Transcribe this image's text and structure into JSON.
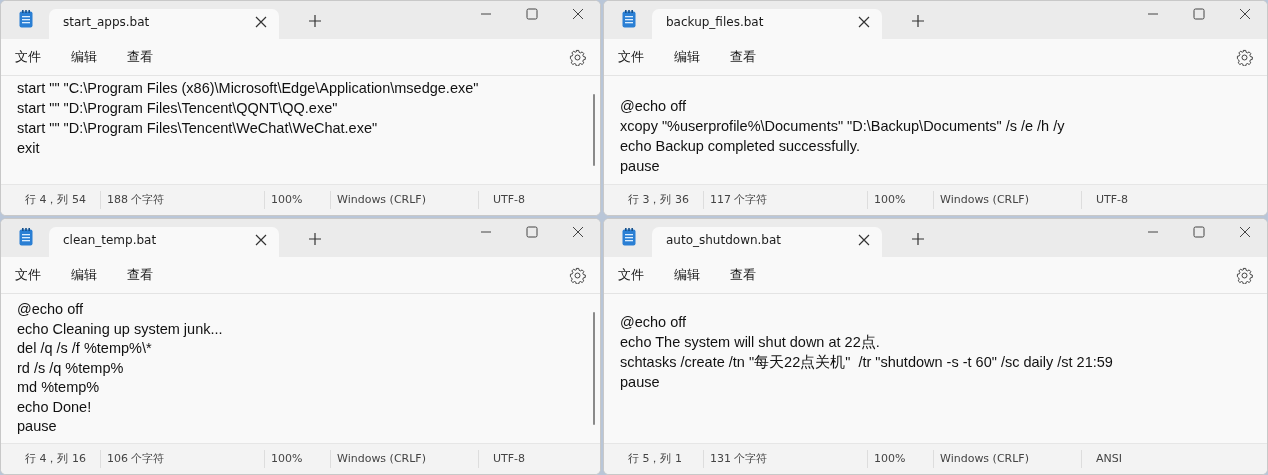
{
  "windows": [
    {
      "tab": {
        "title": "start_apps.bat",
        "selected": true
      },
      "menu": [
        "文件",
        "编辑",
        "查看"
      ],
      "scrollbar": true,
      "lines": [
        "start \"\" \"C:\\Program Files (x86)\\Microsoft\\Edge\\Application\\msedge.exe\"",
        "start \"\" \"D:\\Program Files\\Tencent\\QQNT\\QQ.exe\"",
        "start \"\" \"D:\\Program Files\\Tencent\\WeChat\\WeChat.exe\"",
        "exit"
      ],
      "status": {
        "position": "行 4，列 54",
        "characters": "188 个字符",
        "zoom": "100%",
        "line_ending": "Windows (CRLF)",
        "encoding": "UTF-8"
      }
    },
    {
      "tab": {
        "title": "backup_files.bat",
        "selected": true
      },
      "menu": [
        "文件",
        "编辑",
        "查看"
      ],
      "scrollbar": false,
      "lines": [
        "@echo off",
        "xcopy \"%userprofile%\\Documents\" \"D:\\Backup\\Documents\" /s /e /h /y",
        "echo Backup completed successfully.",
        "pause"
      ],
      "status": {
        "position": "行 3，列 36",
        "characters": "117 个字符",
        "zoom": "100%",
        "line_ending": "Windows (CRLF)",
        "encoding": "UTF-8"
      }
    },
    {
      "tab": {
        "title": "clean_temp.bat",
        "selected": true
      },
      "menu": [
        "文件",
        "编辑",
        "查看"
      ],
      "scrollbar": true,
      "lines": [
        "@echo off",
        "echo Cleaning up system junk...",
        "del /q /s /f %temp%\\*",
        "rd /s /q %temp%",
        "md %temp%",
        "echo Done!",
        "pause"
      ],
      "status": {
        "position": "行 4，列 16",
        "characters": "106 个字符",
        "zoom": "100%",
        "line_ending": "Windows (CRLF)",
        "encoding": "UTF-8"
      }
    },
    {
      "tab": {
        "title": "auto_shutdown.bat",
        "selected": true
      },
      "menu": [
        "文件",
        "编辑",
        "查看"
      ],
      "scrollbar": false,
      "lines": [
        "@echo off",
        "echo The system will shut down at 22点.",
        "schtasks /create /tn \"每天22点关机\"  /tr \"shutdown -s -t 60\" /sc daily /st 21:59",
        "pause"
      ],
      "status": {
        "position": "行 5，列 1",
        "characters": "131 个字符",
        "zoom": "100%",
        "line_ending": "Windows (CRLF)",
        "encoding": "ANSI"
      }
    }
  ]
}
